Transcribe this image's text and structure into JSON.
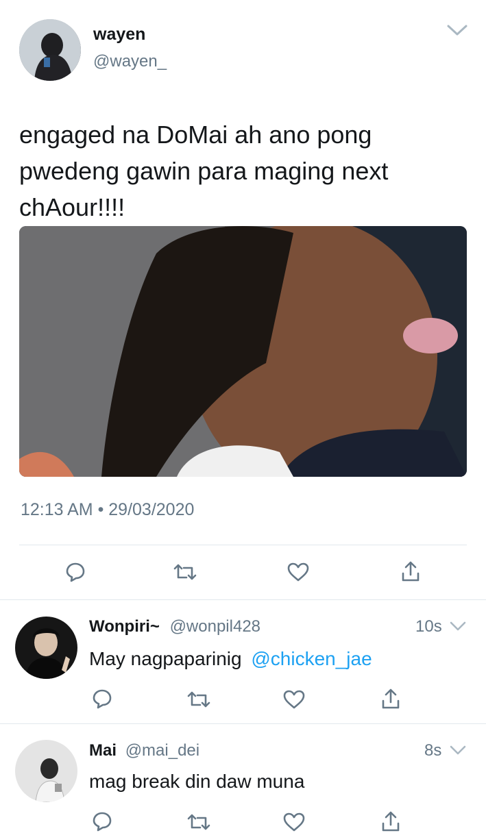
{
  "tweet": {
    "display_name": "wayen",
    "handle": "@wayen_",
    "text": "engaged na DoMai ah ano pong pwedeng gawin para maging next chAour!!!!",
    "timestamp": "12:13 AM • 29/03/2020",
    "image_alt": "photo",
    "actions": [
      "reply-icon",
      "retweet-icon",
      "like-icon",
      "share-icon"
    ]
  },
  "replies": [
    {
      "display_name": "Wonpiri~",
      "handle": "@wonpil428",
      "time": "10s",
      "text_prefix": "May nagpaparinig",
      "mention": "@chicken_jae"
    },
    {
      "display_name": "Mai",
      "handle": "@mai_dei",
      "time": "8s",
      "text_prefix": "mag break din daw muna",
      "mention": ""
    }
  ],
  "colors": {
    "text": "#14171a",
    "muted": "#657786",
    "link": "#1da1f2",
    "divider": "#e1e8ed"
  }
}
